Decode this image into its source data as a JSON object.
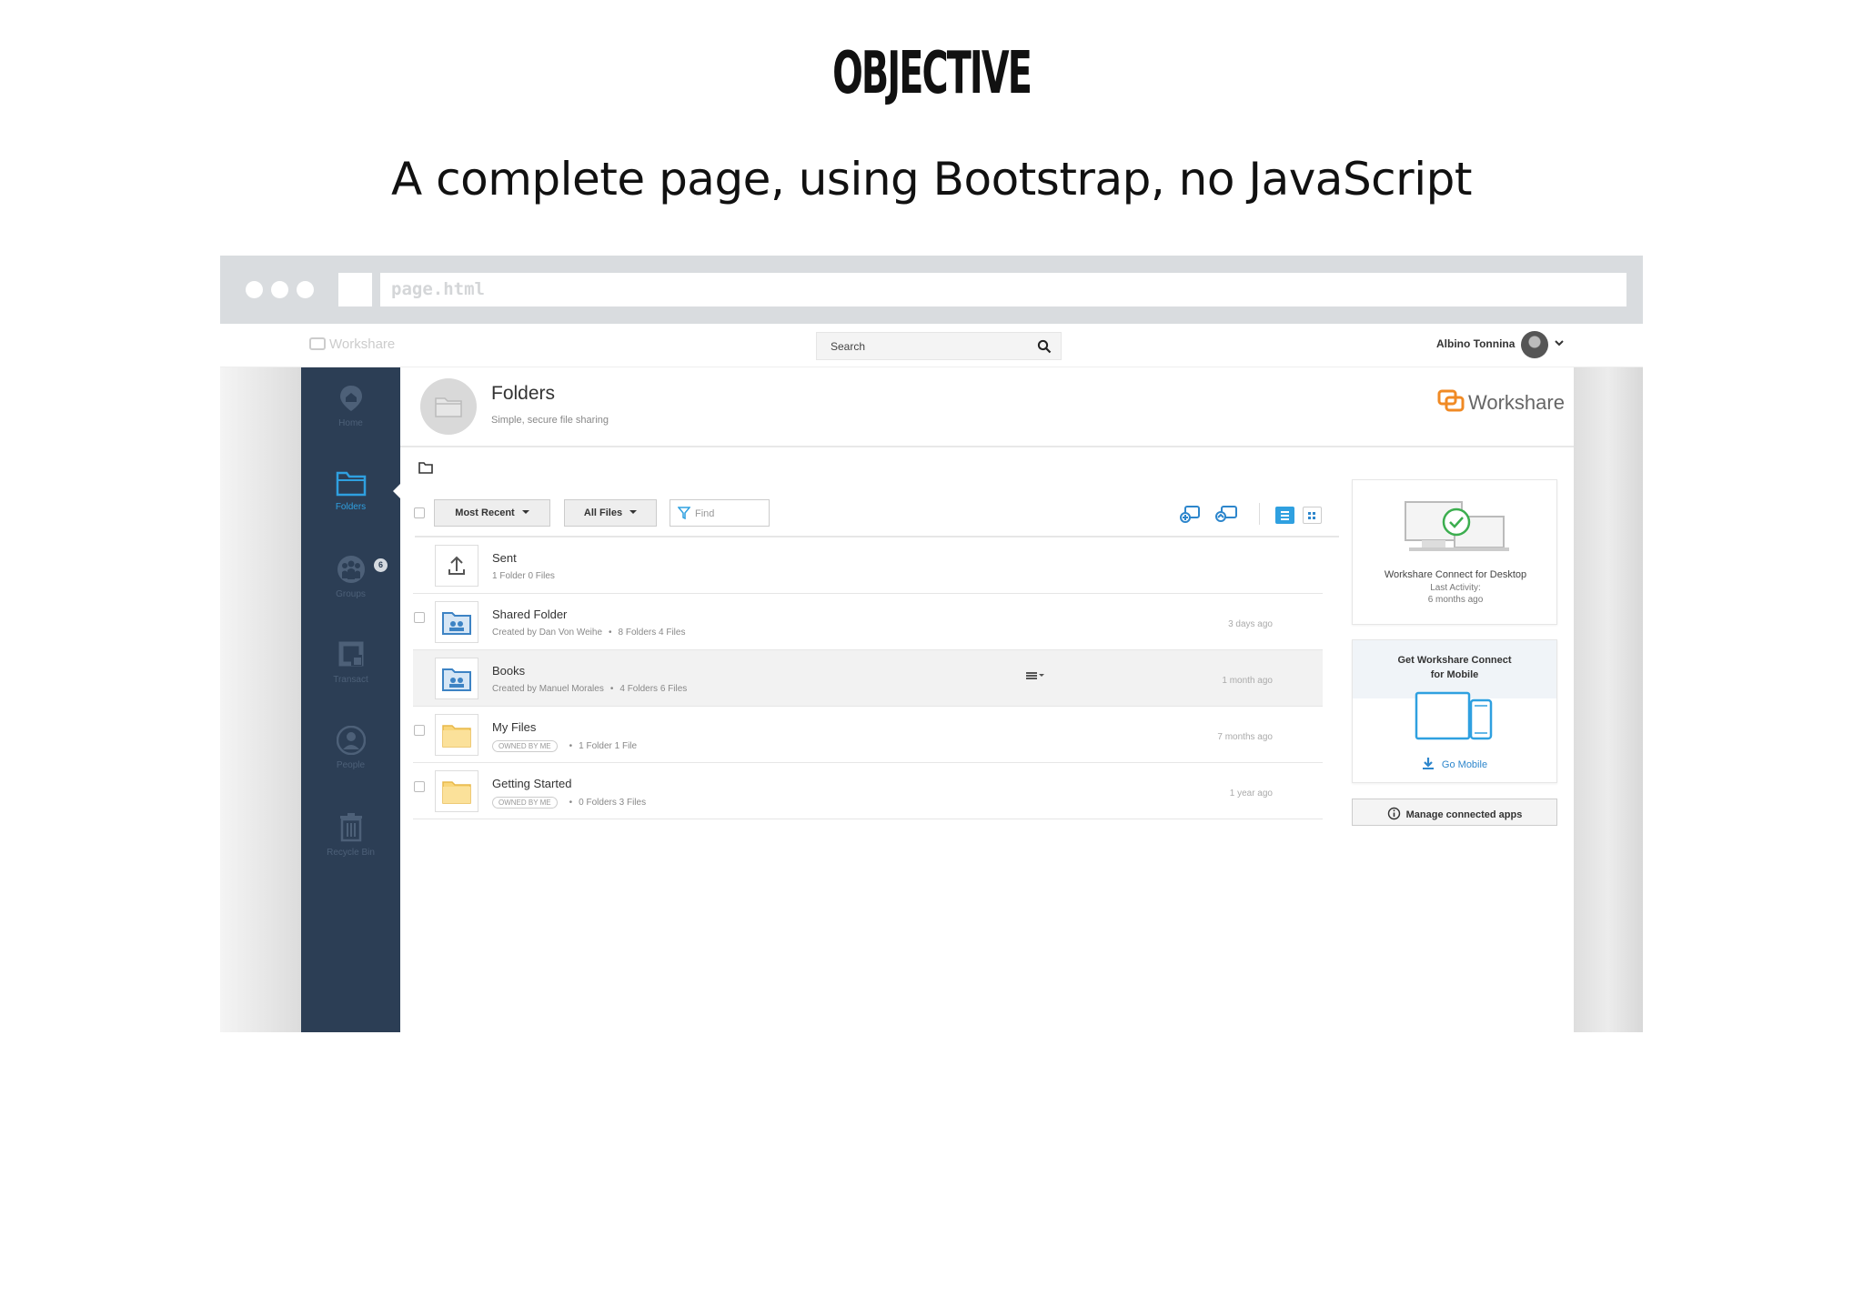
{
  "slide": {
    "title": "OBJECTIVE",
    "subtitle": "A complete page, using Bootstrap, no JavaScript"
  },
  "browser": {
    "address": "page.html"
  },
  "topbar": {
    "brand_faded": "Workshare",
    "search_placeholder": "Search",
    "user_name": "Albino Tonnina"
  },
  "sidebar": {
    "items": [
      {
        "label": "Home",
        "icon": "home-pin-icon",
        "active": false
      },
      {
        "label": "Folders",
        "icon": "folder-icon",
        "active": true
      },
      {
        "label": "Groups",
        "icon": "groups-icon",
        "active": false,
        "badge": "6"
      },
      {
        "label": "Transact",
        "icon": "transact-icon",
        "active": false
      },
      {
        "label": "People",
        "icon": "person-icon",
        "active": false
      },
      {
        "label": "Recycle Bin",
        "icon": "trash-icon",
        "active": false
      }
    ]
  },
  "header": {
    "title": "Folders",
    "subtitle": "Simple, secure file sharing",
    "logo": "Workshare"
  },
  "toolbar": {
    "sort_label": "Most Recent",
    "filter_label": "All Files",
    "find_placeholder": "Find"
  },
  "rows": [
    {
      "name": "Sent",
      "meta": "1 Folder 0 Files",
      "time": "",
      "type": "upload"
    },
    {
      "name": "Shared Folder",
      "meta_a": "Created by Dan Von Weihe",
      "meta_b": "8 Folders 4 Files",
      "time": "3 days ago",
      "type": "shared"
    },
    {
      "name": "Books",
      "meta_a": "Created by Manuel Morales",
      "meta_b": "4 Folders 6 Files",
      "time": "1 month ago",
      "type": "shared"
    },
    {
      "name": "My Files",
      "tag": "OWNED BY ME",
      "meta_b": "1 Folder 1 File",
      "time": "7 months ago",
      "type": "folder"
    },
    {
      "name": "Getting Started",
      "tag": "OWNED BY ME",
      "meta_b": "0 Folders 3 Files",
      "time": "1 year ago",
      "type": "folder"
    }
  ],
  "panel": {
    "desktop_title": "Workshare Connect for Desktop",
    "desktop_activity": "Last Activity:",
    "desktop_when": "6 months ago",
    "mobile_line1": "Get Workshare Connect",
    "mobile_line2": "for Mobile",
    "mobile_link": "Go Mobile",
    "manage_label": "Manage connected apps"
  },
  "colors": {
    "sidebar_bg": "#2c3e55",
    "accent_blue": "#2fa0e0",
    "brand_orange": "#f08a24",
    "success_green": "#3cae4f"
  }
}
